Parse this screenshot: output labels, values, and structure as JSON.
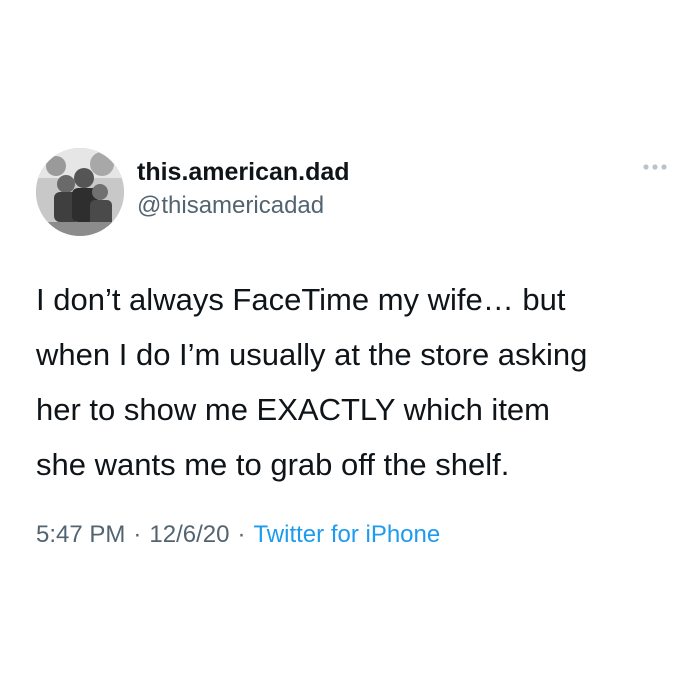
{
  "tweet": {
    "user": {
      "display_name": "this.american.dad",
      "handle": "@thisamericadad"
    },
    "more_icon": "more-dots-icon",
    "text_lines": [
      "I don’t always FaceTime my wife… but",
      "when I do I’m usually at the store asking",
      "her to show me EXACTLY which item",
      "she wants me to grab off the shelf."
    ],
    "meta": {
      "time": "5:47 PM",
      "separator": "·",
      "date": "12/6/20",
      "source": "Twitter for iPhone"
    }
  },
  "colors": {
    "text": "#0f1419",
    "secondary": "#536471",
    "link": "#1d9bf0",
    "background": "#ffffff"
  }
}
